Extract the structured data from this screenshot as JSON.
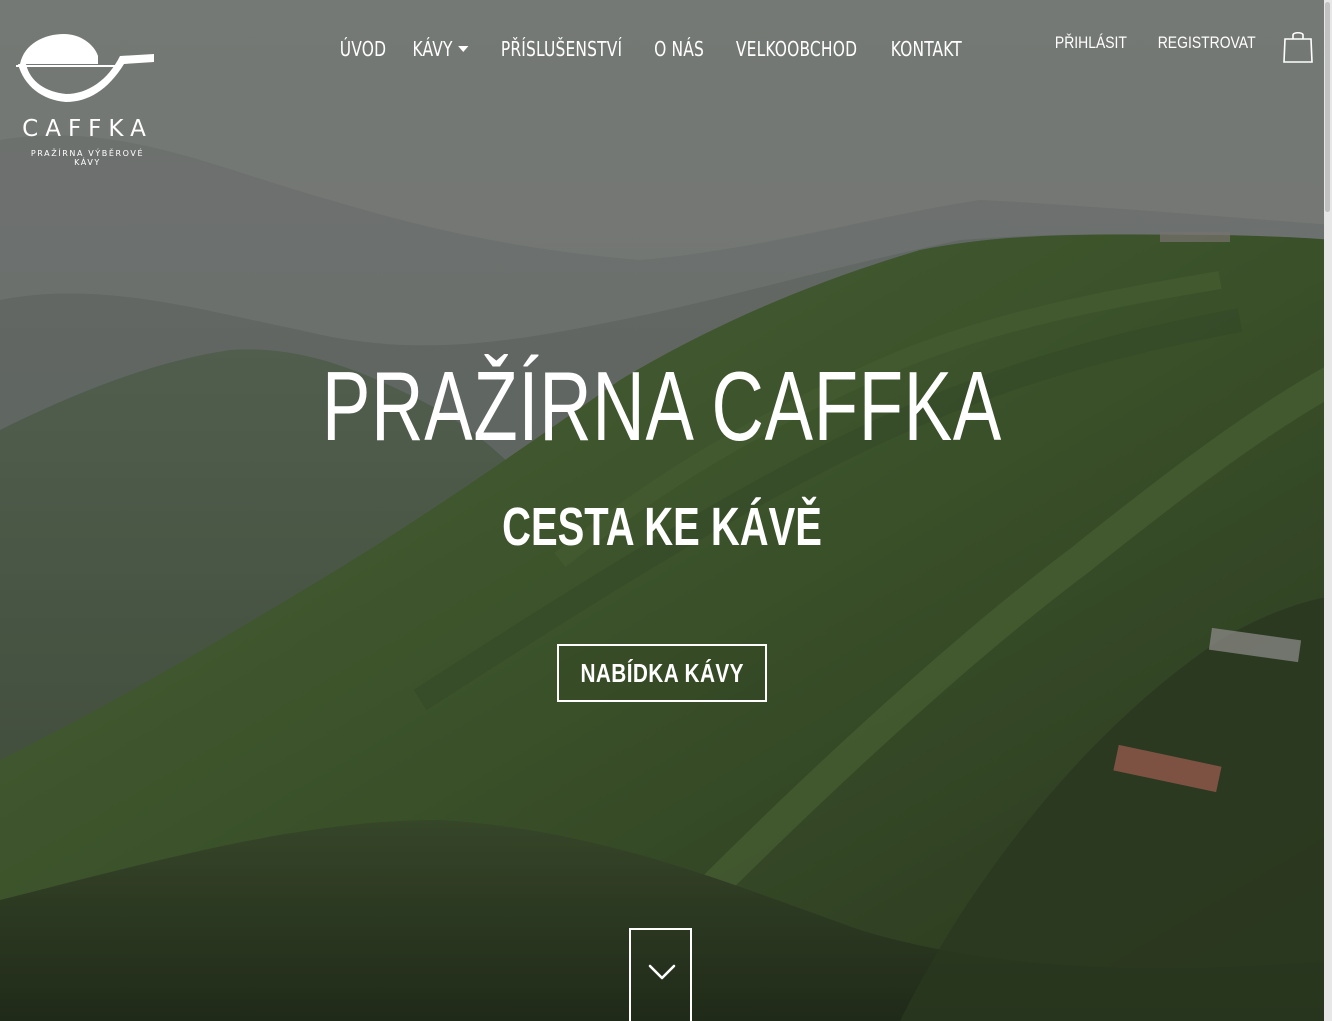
{
  "brand": {
    "name": "CAFFKA",
    "tagline": "PRAŽÍRNA VÝBĚROVÉ KÁVY",
    "logo_icon": "coffee-cup-logo-icon"
  },
  "nav": {
    "items": [
      {
        "label": "ÚVOD"
      },
      {
        "label": "KÁVY",
        "has_dropdown": true
      },
      {
        "label": "PŘÍSLUŠENSTVÍ"
      },
      {
        "label": "O NÁS"
      },
      {
        "label": "VELKOOBCHOD"
      },
      {
        "label": "KONTAKT"
      }
    ]
  },
  "user": {
    "login_label": "PŘIHLÁSIT",
    "register_label": "REGISTROVAT",
    "cart_icon": "shopping-bag-icon"
  },
  "hero": {
    "title": "PRAŽÍRNA CAFFKA",
    "subtitle": "CESTA KE KÁVĚ",
    "cta_label": "NABÍDKA KÁVY",
    "scroll_icon": "chevron-down-icon",
    "background_description_color": "#4a5a3c"
  },
  "colors": {
    "text": "#ffffff",
    "hill_dark": "#2f3f25",
    "mist": "#8a8f8a"
  }
}
